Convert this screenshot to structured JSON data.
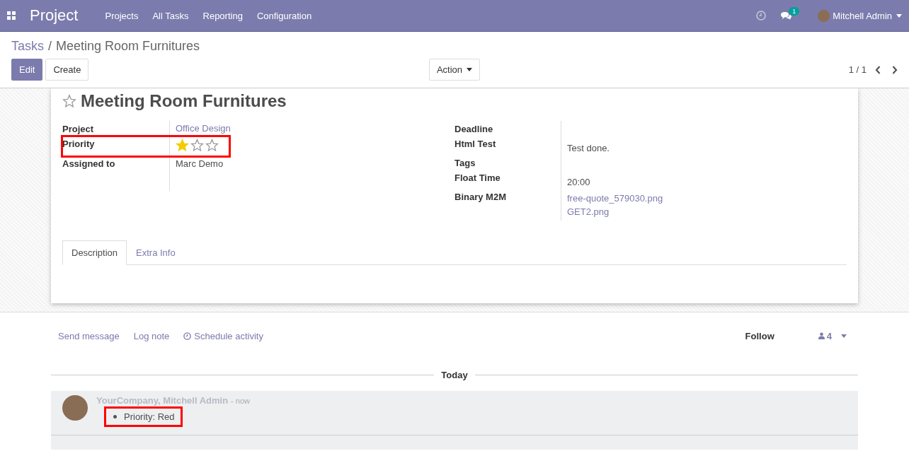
{
  "navbar": {
    "app_name": "Project",
    "menu": [
      "Projects",
      "All Tasks",
      "Reporting",
      "Configuration"
    ],
    "message_count": "1",
    "user": "Mitchell Admin"
  },
  "breadcrumb": {
    "parent": "Tasks",
    "separator": "/",
    "current": "Meeting Room Furnitures"
  },
  "buttons": {
    "edit": "Edit",
    "create": "Create",
    "action": "Action"
  },
  "pager": "1 / 1",
  "form": {
    "title": "Meeting Room Furnitures",
    "starred": false,
    "left_fields": [
      {
        "label": "Project",
        "kind": "link",
        "value": "Office Design"
      },
      {
        "label": "Priority",
        "kind": "stars",
        "stars": 1,
        "highlighted": true
      },
      {
        "label": "Assigned to",
        "kind": "text",
        "value": "Marc Demo"
      }
    ],
    "right_fields": [
      {
        "label": "Deadline",
        "kind": "text"
      },
      {
        "label": "Html Test",
        "kind": "text",
        "value": "Test done."
      },
      {
        "label": "Tags",
        "kind": "text"
      },
      {
        "label": "Float Time",
        "kind": "text",
        "value": "20:00"
      },
      {
        "label": "Binary M2M",
        "kind": "links",
        "values": [
          "free-quote_579030.png",
          "GET2.png"
        ]
      }
    ],
    "tabs": [
      {
        "label": "Description",
        "selected": true
      },
      {
        "label": "Extra Info",
        "selected": false
      }
    ]
  },
  "chatter": {
    "actions": [
      "Send message",
      "Log note",
      "Schedule activity"
    ],
    "follow": "Follow",
    "followers": "4",
    "separator": "Today",
    "messages": [
      {
        "author": "YourCompany, Mitchell Admin",
        "time": "- now",
        "changes": [
          "Priority: Red"
        ],
        "highlighted": true
      }
    ]
  }
}
